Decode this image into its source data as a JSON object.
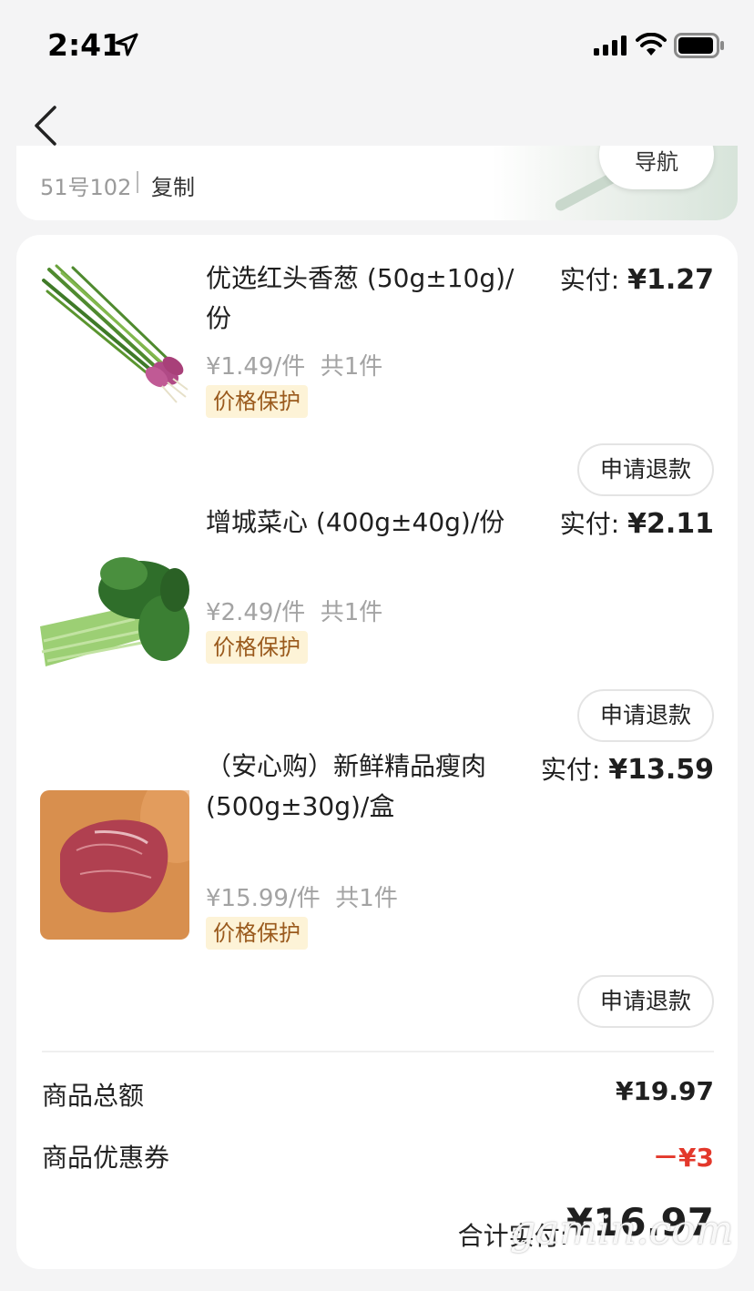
{
  "status_bar": {
    "time": "2:41"
  },
  "address": {
    "room": "51号102",
    "copy_label": "复制",
    "nav_label": "导航"
  },
  "items": [
    {
      "name": "优选红头香葱 (50g±10g)/份",
      "paid_label": "实付:",
      "paid_amount": "¥1.27",
      "unit_price": "¥1.49/件",
      "quantity": "共1件",
      "tag": "价格保护",
      "refund_label": "申请退款"
    },
    {
      "name": "增城菜心 (400g±40g)/份",
      "paid_label": "实付:",
      "paid_amount": "¥2.11",
      "unit_price": "¥2.49/件",
      "quantity": "共1件",
      "tag": "价格保护",
      "refund_label": "申请退款"
    },
    {
      "name": "（安心购）新鲜精品瘦肉(500g±30g)/盒",
      "paid_label": "实付:",
      "paid_amount": "¥13.59",
      "unit_price": "¥15.99/件",
      "quantity": "共1件",
      "tag": "价格保护",
      "refund_label": "申请退款"
    }
  ],
  "summary": {
    "subtotal_label": "商品总额",
    "subtotal_value": "¥19.97",
    "coupon_label": "商品优惠券",
    "coupon_value": "－¥3",
    "total_label": "合计实付:",
    "total_value": "¥16.97"
  },
  "watermark": "gamin.com",
  "colors": {
    "accent_red": "#e3382b",
    "tag_bg": "#fdf3d7",
    "tag_text": "#9a5a1d"
  }
}
